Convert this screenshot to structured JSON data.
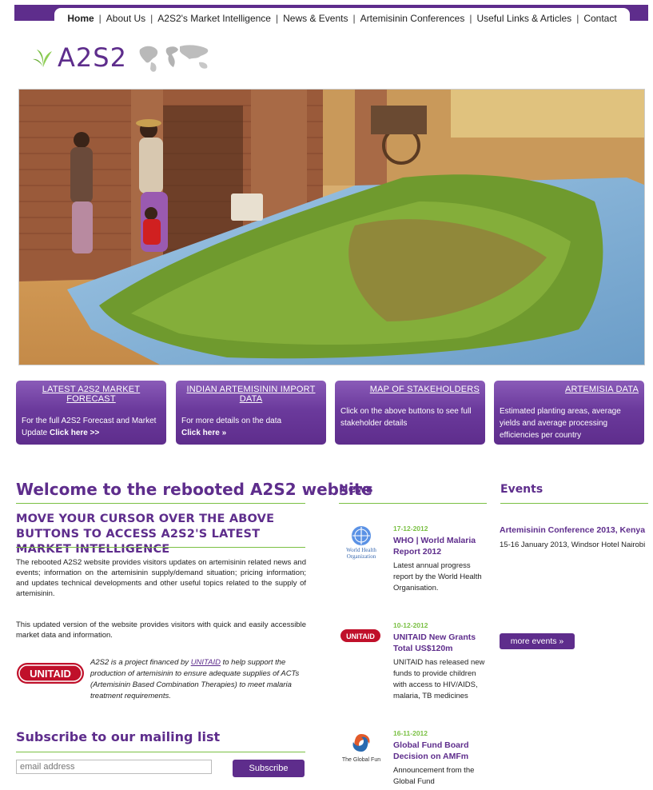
{
  "nav": {
    "items": [
      {
        "label": "Home",
        "active": true
      },
      {
        "label": "About Us"
      },
      {
        "label": "A2S2's Market Intelligence"
      },
      {
        "label": "News & Events"
      },
      {
        "label": "Artemisinin Conferences"
      },
      {
        "label": "Useful Links & Articles"
      },
      {
        "label": "Contact"
      }
    ]
  },
  "logo": {
    "name": "A2S2"
  },
  "features": [
    {
      "title": "LATEST A2S2 MARKET FORECAST",
      "body": "For the full A2S2 Forecast and Market Update ",
      "link": "Click here >>"
    },
    {
      "title": "INDIAN ARTEMISININ IMPORT DATA",
      "body": "For more details on the data",
      "link": "Click here »"
    },
    {
      "title": "MAP OF STAKEHOLDERS",
      "body": "Click on the above buttons to see full stakeholder details",
      "link": ""
    },
    {
      "title": "ARTEMISIA DATA",
      "body": "Estimated planting areas, average yields and average processing efficiencies per country",
      "link": ""
    }
  ],
  "welcome": {
    "title": "Welcome to the rebooted A2S2 website",
    "subhead": "MOVE YOUR CURSOR OVER THE ABOVE BUTTONS TO ACCESS A2S2'S LATEST MARKET INTELLIGENCE",
    "para1": "The rebooted A2S2 website provides visitors updates on artemisinin related news and events; information on the artemisinin supply/demand situation; pricing information; and updates technical developments and other useful topics related to the supply of artemisinin.",
    "para2": "This updated version of the website provides visitors with quick and easily accessible market data and information.",
    "funded_prefix": "A2S2 is a project financed by ",
    "funded_link": "UNITAID",
    "funded_suffix": " to help support the production of artemisinin to ensure adequate supplies of ACTs (Artemisinin Based Combination Therapies) to meet malaria treatment requirements.",
    "unitaid_logo_text": "UNITAID"
  },
  "subscribe": {
    "title": "Subscribe to our mailing list",
    "placeholder": "email address",
    "button": "Subscribe"
  },
  "news": {
    "title": "News",
    "items": [
      {
        "date": "17-12-2012",
        "title": "WHO | World Malaria Report 2012",
        "desc": "Latest annual progress report by the World Health Organisation.",
        "logo_text": "World Health Organization"
      },
      {
        "date": "10-12-2012",
        "title": "UNITAID New Grants Total US$120m",
        "desc": "UNITAID has released new funds to provide children with access to HIV/AIDS, malaria, TB medicines",
        "logo_text": "UNITAID"
      },
      {
        "date": "16-11-2012",
        "title": "Global Fund Board Decision on AMFm",
        "desc": "Announcement from the Global Fund",
        "logo_text": "The Global Fun"
      }
    ]
  },
  "events": {
    "title": "Events",
    "items": [
      {
        "title": "Artemisinin Conference 2013, Kenya",
        "desc": "15-16 January 2013, Windsor Hotel Nairobi"
      }
    ],
    "more_label": "more events »"
  },
  "colors": {
    "brand": "#5e2d8c",
    "accent_green": "#7ac043"
  }
}
